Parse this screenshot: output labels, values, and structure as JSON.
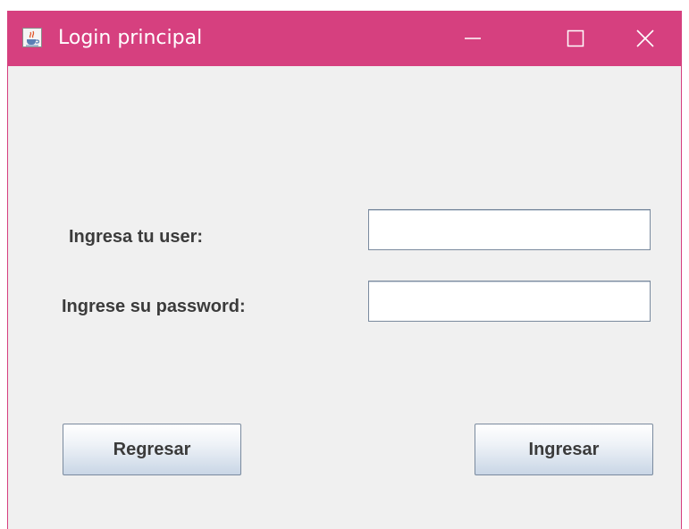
{
  "window": {
    "title": "Login principal",
    "title_icon": "java-cup-icon",
    "titlebar_color": "#d6407f",
    "background_color": "#f0f0f0"
  },
  "form": {
    "user_label": "Ingresa tu user:",
    "user_value": "",
    "password_label": "Ingrese su password:",
    "password_value": ""
  },
  "buttons": {
    "back_label": "Regresar",
    "login_label": "Ingresar"
  }
}
